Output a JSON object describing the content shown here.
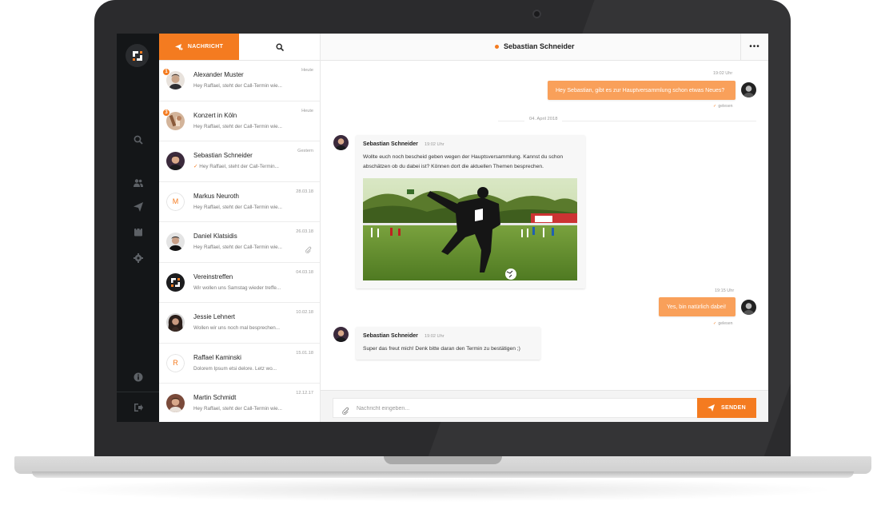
{
  "toolbar": {
    "new_label": "NACHRICHT",
    "new_icon": "new-message-icon",
    "search_icon": "search-icon"
  },
  "nav": {
    "items": [
      "search-icon",
      "contacts-icon",
      "send-icon",
      "calendar-icon",
      "settings-icon",
      "info-icon",
      "logout-icon"
    ]
  },
  "conversations": [
    {
      "name": "Alexander Muster",
      "preview": "Hey Raffael, steht der Call-Termin wie...",
      "time": "Heute",
      "badge": "1"
    },
    {
      "name": "Konzert in Köln",
      "preview": "Hey Raffael, steht der Call-Termin wie...",
      "time": "Heute",
      "badge": "3"
    },
    {
      "name": "Sebastian Schneider",
      "preview": "Hey Raffael, steht der Call-Termin...",
      "time": "Gestern",
      "tick": "✓"
    },
    {
      "name": "Markus Neuroth",
      "preview": "Hey Raffael, steht der Call-Termin wie...",
      "time": "28.03.18",
      "initial": "M"
    },
    {
      "name": "Daniel Klatsidis",
      "preview": "Hey Raffael, steht der Call-Termin wie...",
      "time": "26.03.18"
    },
    {
      "name": "Vereinstreffen",
      "preview": "Wir wollen uns Samstag wieder treffe...",
      "time": "04.03.18"
    },
    {
      "name": "Jessie Lehnert",
      "preview": "Wollen wir uns noch mal besprechen...",
      "time": "10.02.18"
    },
    {
      "name": "Raffael Kaminski",
      "preview": "Dolorem Ipsum etsi delore. Letz wo...",
      "time": "15.01.18",
      "initial": "R"
    },
    {
      "name": "Martin Schmidt",
      "preview": "Hey Raffael, steht der Call-Termin wie...",
      "time": "12.12.17"
    }
  ],
  "chat": {
    "title": "Sebastian Schneider",
    "more_label": "•••",
    "messages": {
      "m1": {
        "time": "19:02 Uhr",
        "text": "Hey Sebastian, gibt es zur Hauptversammlung schon etwas Neues?",
        "status": "gelesen",
        "tick": "✓"
      },
      "date": "04. April 2018",
      "m2": {
        "sender": "Sebastian Schneider",
        "time": "19:02 Uhr",
        "line1": "Wollte euch noch bescheid geben wegen der Hauptsversammlung. Kannst du schon",
        "line2": "abschätzen ob du dabei ist? Können dort die aktuellen Themen besprechen."
      },
      "m3": {
        "time": "19:15 Uhr",
        "text": "Yes, bin natürlich dabei!",
        "status": "gelesen",
        "tick": "✓"
      },
      "m4": {
        "sender": "Sebastian Schneider",
        "time": "19:02 Uhr",
        "text": "Super das freut mich! Denk bitte daran den Termin zu bestätigen ;)"
      }
    }
  },
  "composer": {
    "placeholder": "Nachricht eingeben...",
    "send_label": "SENDEN"
  },
  "colors": {
    "accent": "#f47b20",
    "bubble_out": "#f9a05a",
    "rail": "#141618"
  }
}
